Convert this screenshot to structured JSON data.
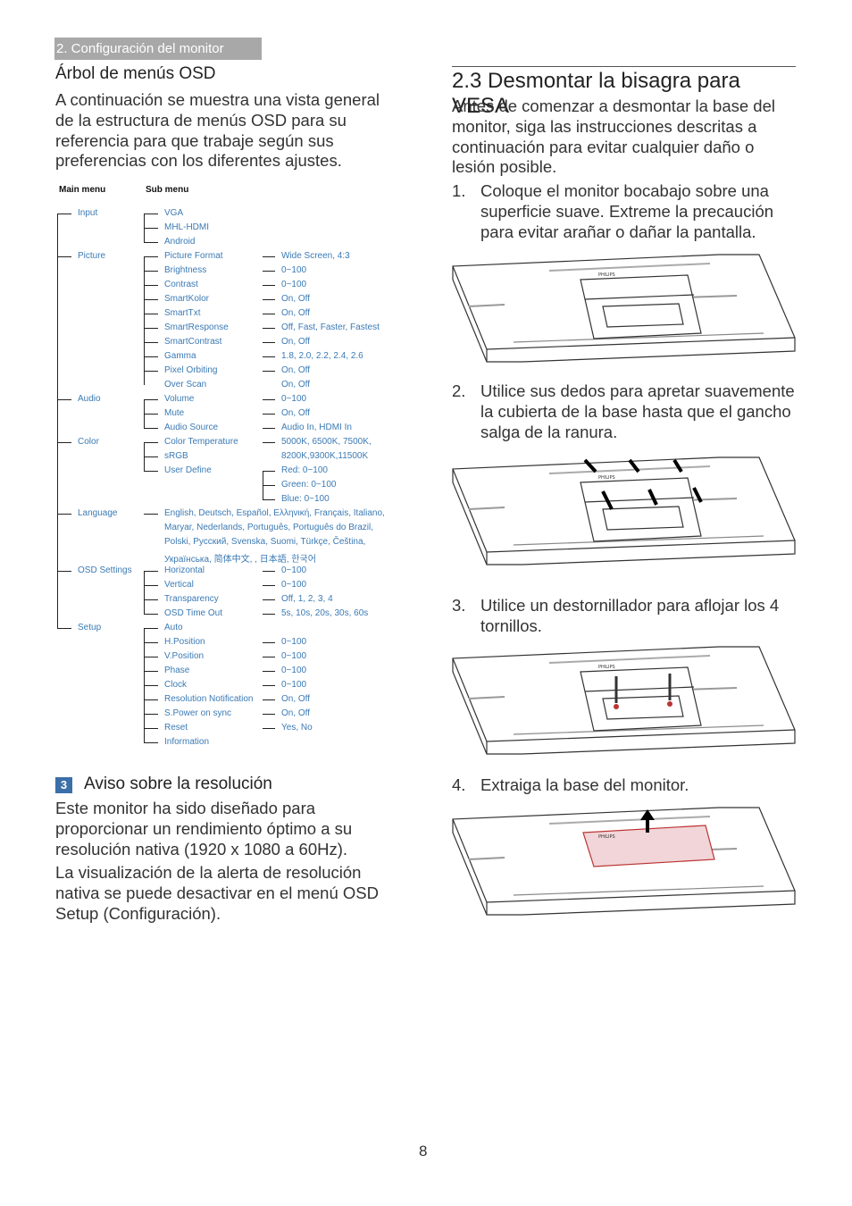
{
  "header": {
    "section": "2. Configuración del monitor"
  },
  "osd": {
    "title": "Árbol de menús OSD",
    "intro": "A continuación se muestra una vista general de la estructura de menús OSD para su referencia para que trabaje según sus preferencias con los diferentes ajustes.",
    "col_main": "Main menu",
    "col_sub": "Sub menu",
    "tree": [
      {
        "main": "Input",
        "row": 0,
        "subs": [
          {
            "label": "VGA",
            "row": 0
          },
          {
            "label": "MHL-HDMI",
            "row": 1
          },
          {
            "label": "Android",
            "row": 2
          }
        ]
      },
      {
        "main": "Picture",
        "row": 3,
        "subs": [
          {
            "label": "Picture Format",
            "row": 3,
            "values": [
              "Wide Screen, 4:3"
            ]
          },
          {
            "label": "Brightness",
            "row": 4,
            "values": [
              "0~100"
            ]
          },
          {
            "label": "Contrast",
            "row": 5,
            "values": [
              "0~100"
            ]
          },
          {
            "label": "SmartKolor",
            "row": 6,
            "values": [
              "On, Off"
            ]
          },
          {
            "label": "SmartTxt",
            "row": 7,
            "values": [
              "On, Off"
            ]
          },
          {
            "label": "SmartResponse",
            "row": 8,
            "values": [
              "Off, Fast, Faster, Fastest"
            ]
          },
          {
            "label": "SmartContrast",
            "row": 9,
            "values": [
              "On, Off"
            ]
          },
          {
            "label": "Gamma",
            "row": 10,
            "values": [
              "1.8, 2.0, 2.2, 2.4, 2.6"
            ]
          },
          {
            "label": "Pixel Orbiting",
            "row": 11,
            "values": [
              "On, Off"
            ]
          },
          {
            "label": "Over Scan",
            "row": 12,
            "values": [
              "On, Off"
            ],
            "nodash": true
          }
        ]
      },
      {
        "main": "Audio",
        "row": 13,
        "subs": [
          {
            "label": "Volume",
            "row": 13,
            "values": [
              "0~100"
            ]
          },
          {
            "label": "Mute",
            "row": 14,
            "values": [
              "On, Off"
            ]
          },
          {
            "label": "Audio Source",
            "row": 15,
            "values": [
              "Audio In, HDMI In"
            ]
          }
        ]
      },
      {
        "main": "Color",
        "row": 16,
        "subs": [
          {
            "label": "Color Temperature",
            "row": 16,
            "values": [
              "5000K, 6500K, 7500K,",
              "8200K,9300K,11500K"
            ]
          },
          {
            "label": "sRGB",
            "row": 17
          },
          {
            "label": "User Define",
            "row": 18,
            "values": [
              "Red: 0~100",
              "Green: 0~100",
              "Blue: 0~100"
            ],
            "bracket": true
          }
        ]
      },
      {
        "main": "Language",
        "row": 21,
        "single": true,
        "subs": [
          {
            "label": "English, Deutsch, Español, Ελληνική, Français, Italiano,",
            "row": 21
          },
          {
            "label": "Maryar, Nederlands, Português, Português do Brazil,",
            "row": 22,
            "nodash": true
          },
          {
            "label": "Polski, Русский, Svenska, Suomi, Türkçe, Čeština,",
            "row": 23,
            "nodash": true
          },
          {
            "label": "Українська, 简体中文,            , 日本語, 한국어",
            "row": 24,
            "nodash": true
          }
        ]
      },
      {
        "main": "OSD Settings",
        "row": 25,
        "subs": [
          {
            "label": "Horizontal",
            "row": 25,
            "values": [
              "0~100"
            ]
          },
          {
            "label": "Vertical",
            "row": 26,
            "values": [
              "0~100"
            ]
          },
          {
            "label": "Transparency",
            "row": 27,
            "values": [
              "Off, 1, 2, 3, 4"
            ]
          },
          {
            "label": "OSD Time Out",
            "row": 28,
            "values": [
              "5s, 10s, 20s, 30s, 60s"
            ]
          }
        ]
      },
      {
        "main": "Setup",
        "row": 29,
        "subs": [
          {
            "label": "Auto",
            "row": 29
          },
          {
            "label": "H.Position",
            "row": 30,
            "values": [
              "0~100"
            ]
          },
          {
            "label": "V.Position",
            "row": 31,
            "values": [
              "0~100"
            ]
          },
          {
            "label": "Phase",
            "row": 32,
            "values": [
              "0~100"
            ]
          },
          {
            "label": "Clock",
            "row": 33,
            "values": [
              "0~100"
            ]
          },
          {
            "label": "Resolution Notification",
            "row": 34,
            "values": [
              "On, Off"
            ]
          },
          {
            "label": "S.Power on sync",
            "row": 35,
            "values": [
              "On, Off"
            ]
          },
          {
            "label": "Reset",
            "row": 36,
            "values": [
              "Yes, No"
            ]
          },
          {
            "label": "Information",
            "row": 37
          }
        ]
      }
    ]
  },
  "resolution": {
    "number": "3",
    "title": "Aviso sobre la resolución",
    "p1": "Este monitor ha sido diseñado para proporcionar un rendimiento óptimo a su resolución nativa (1920 x 1080 a 60Hz).",
    "p2": "La visualización de la alerta de resolución nativa se puede desactivar en el menú OSD Setup (Configuración)."
  },
  "vesa": {
    "title": "2.3  Desmontar la bisagra para VESA",
    "intro": "Antes de comenzar a desmontar la base del monitor, siga las instrucciones descritas a continuación para evitar cualquier daño o lesión posible.",
    "steps": [
      {
        "n": "1.",
        "text": "Coloque el monitor bocabajo sobre una superficie suave. Extreme la precaución para evitar arañar o dañar la pantalla."
      },
      {
        "n": "2.",
        "text": "Utilice sus dedos para apretar suavemente la cubierta de la base hasta que el gancho salga de la ranura."
      },
      {
        "n": "3.",
        "text": "Utilice un destornillador para aflojar los 4 tornillos."
      },
      {
        "n": "4.",
        "text": "Extraiga la base del monitor."
      }
    ],
    "brand_mark": "PHILIPS"
  },
  "page_number": "8"
}
